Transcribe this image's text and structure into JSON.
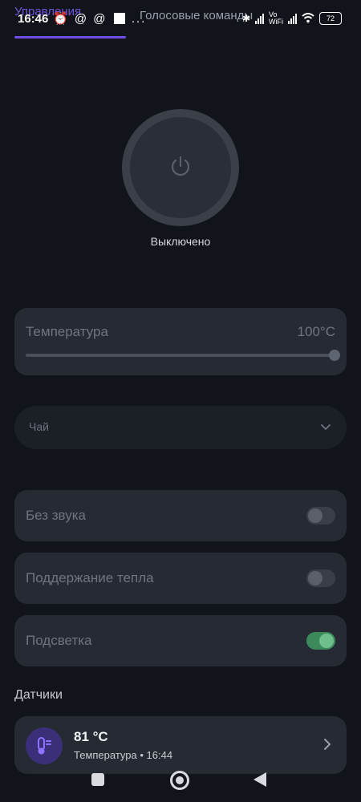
{
  "tabs": {
    "active_label": "Управления",
    "voice_label": "Голосовые команды"
  },
  "status_bar": {
    "time": "16:46",
    "left_icons": "@ @",
    "more": "...",
    "wifi_label": "Vo WiFi",
    "battery": "72"
  },
  "power": {
    "status": "Выключено"
  },
  "temperature": {
    "label": "Температура",
    "value": "100°C",
    "slider_fraction": 1.0
  },
  "mode_select": {
    "value": "Чай"
  },
  "toggles": [
    {
      "label": "Без звука",
      "on": false
    },
    {
      "label": "Поддержание тепла",
      "on": false
    },
    {
      "label": "Подсветка",
      "on": true
    }
  ],
  "sensors": {
    "title": "Датчики",
    "items": [
      {
        "value": "81 °C",
        "subtitle": "Температура • 16:44"
      }
    ]
  },
  "colors": {
    "accent": "#6f4fe6",
    "toggle_on": "#3c8a5b",
    "sensor_icon_bg": "#3b2f7a"
  }
}
